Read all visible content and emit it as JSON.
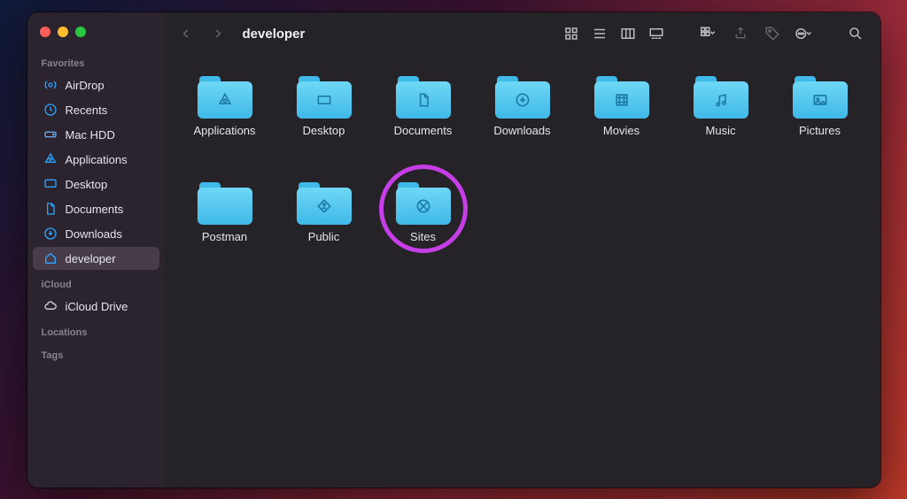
{
  "window_title": "developer",
  "sidebar": {
    "favorites_label": "Favorites",
    "icloud_label": "iCloud",
    "locations_label": "Locations",
    "tags_label": "Tags",
    "favorites": [
      {
        "label": "AirDrop",
        "icon": "airdrop"
      },
      {
        "label": "Recents",
        "icon": "clock"
      },
      {
        "label": "Mac HDD",
        "icon": "disk"
      },
      {
        "label": "Applications",
        "icon": "apps"
      },
      {
        "label": "Desktop",
        "icon": "desktop"
      },
      {
        "label": "Documents",
        "icon": "doc"
      },
      {
        "label": "Downloads",
        "icon": "download"
      },
      {
        "label": "developer",
        "icon": "home",
        "selected": true
      }
    ],
    "icloud": [
      {
        "label": "iCloud Drive",
        "icon": "cloud"
      }
    ]
  },
  "folders": [
    {
      "label": "Applications",
      "glyph": "apps"
    },
    {
      "label": "Desktop",
      "glyph": "desktop"
    },
    {
      "label": "Documents",
      "glyph": "doc"
    },
    {
      "label": "Downloads",
      "glyph": "download"
    },
    {
      "label": "Movies",
      "glyph": "film"
    },
    {
      "label": "Music",
      "glyph": "music"
    },
    {
      "label": "Pictures",
      "glyph": "image"
    },
    {
      "label": "Postman",
      "glyph": ""
    },
    {
      "label": "Public",
      "glyph": "public"
    },
    {
      "label": "Sites",
      "glyph": "sites",
      "highlight": true
    }
  ]
}
